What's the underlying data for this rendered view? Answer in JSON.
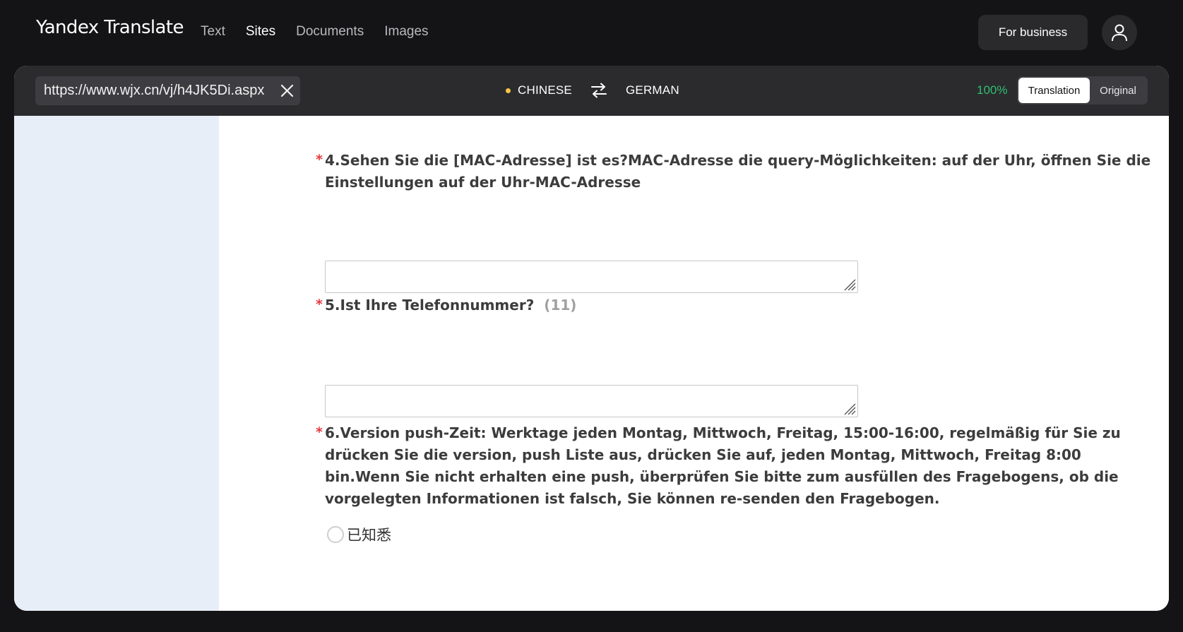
{
  "header": {
    "brand": "Yandex Translate",
    "nav": [
      {
        "label": "Text",
        "active": false
      },
      {
        "label": "Sites",
        "active": true
      },
      {
        "label": "Documents",
        "active": false
      },
      {
        "label": "Images",
        "active": false
      }
    ],
    "business_button": "For business"
  },
  "toolbar": {
    "url": "https://www.wjx.cn/vj/h4JK5Di.aspx",
    "source_lang": "CHINESE",
    "target_lang": "GERMAN",
    "zoom": "100%",
    "mode_translation": "Translation",
    "mode_original": "Original"
  },
  "form": {
    "q4": {
      "required_mark": "*",
      "text": "4.Sehen Sie die [MAC-Adresse] ist es?MAC-Adresse die query-Möglichkeiten: auf der Uhr, öffnen Sie die Einstellungen auf der Uhr-MAC-Adresse",
      "value": ""
    },
    "q5": {
      "required_mark": "*",
      "text": "5.Ist Ihre Telefonnummer?",
      "hint": "(11)",
      "value": ""
    },
    "q6": {
      "required_mark": "*",
      "text": "6.Version push-Zeit: Werktage jeden Montag, Mittwoch, Freitag, 15:00-16:00, regelmäßig für Sie zu drücken Sie die version, push Liste aus, drücken Sie auf, jeden Montag, Mittwoch, Freitag 8:00 bin.Wenn Sie nicht erhalten eine push, überprüfen Sie bitte zum ausfüllen des Fragebogens, ob die vorgelegten Informationen ist falsch, Sie können re-senden den Fragebogen.",
      "option_label": "已知悉",
      "option_checked": false
    }
  },
  "colors": {
    "background": "#141416",
    "toolbar": "#2b2b2e",
    "zoom": "#2fbf71",
    "lang_dot": "#f5c542",
    "required": "#e4393c",
    "side_strip": "#e8eef7"
  }
}
